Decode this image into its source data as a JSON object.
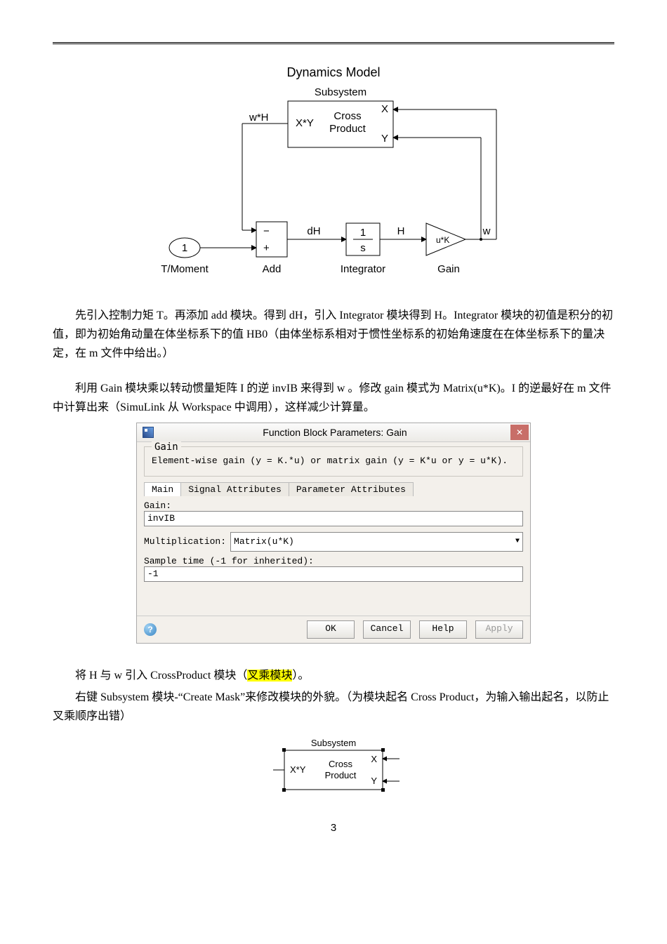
{
  "diagram1": {
    "title": "Dynamics Model",
    "subsystem_label": "Subsystem",
    "cross_out": "X*Y",
    "cross_text1": "Cross",
    "cross_text2": "Product",
    "cross_in_x": "X",
    "cross_in_y": "Y",
    "wH": "w*H",
    "port_num": "1",
    "port_label": "T/Moment",
    "add_minus": "−",
    "add_plus": "+",
    "add_label": "Add",
    "dH": "dH",
    "int_top": "1",
    "int_bot": "s",
    "int_label": "Integrator",
    "H": "H",
    "gain_text": "u*K",
    "gain_label": "Gain",
    "w": "w"
  },
  "para1": "先引入控制力矩 T。再添加 add 模块。得到 dH，引入 Integrator 模块得到 H。Integrator 模块的初值是积分的初值，即为初始角动量在体坐标系下的值 HB0（由体坐标系相对于惯性坐标系的初始角速度在在体坐标系下的量决定，在 m 文件中给出。）",
  "para2": "利用 Gain 模块乘以转动惯量矩阵 I 的逆 invIB 来得到 w 。修改 gain 模式为 Matrix(u*K)。I 的逆最好在 m 文件中计算出来（SimuLink 从 Workspace 中调用），这样减少计算量。",
  "dialog": {
    "title": "Function Block Parameters: Gain",
    "close_glyph": "✕",
    "group_title": "Gain",
    "group_desc": "Element-wise gain (y = K.*u) or matrix gain (y = K*u or y = u*K).",
    "tabs": [
      "Main",
      "Signal Attributes",
      "Parameter Attributes"
    ],
    "gain_label": "Gain:",
    "gain_value": "invIB",
    "mult_label": "Multiplication:",
    "mult_value": "Matrix(u*K)",
    "sample_label": "Sample time (-1 for inherited):",
    "sample_value": "-1",
    "help_glyph": "?",
    "buttons": {
      "ok": "OK",
      "cancel": "Cancel",
      "help": "Help",
      "apply": "Apply"
    }
  },
  "para3_pre": "将 H 与 w 引入 CrossProduct 模块（",
  "para3_hl": "叉乘模块",
  "para3_post": "）。",
  "para4": "右键 Subsystem 模块-“Create Mask”来修改模块的外貌。（为模块起名 Cross Product，为输入输出起名，以防止叉乘顺序出错）",
  "diagram2": {
    "subsystem_label": "Subsystem",
    "out": "X*Y",
    "text1": "Cross",
    "text2": "Product",
    "in_x": "X",
    "in_y": "Y"
  },
  "page_number": "3"
}
